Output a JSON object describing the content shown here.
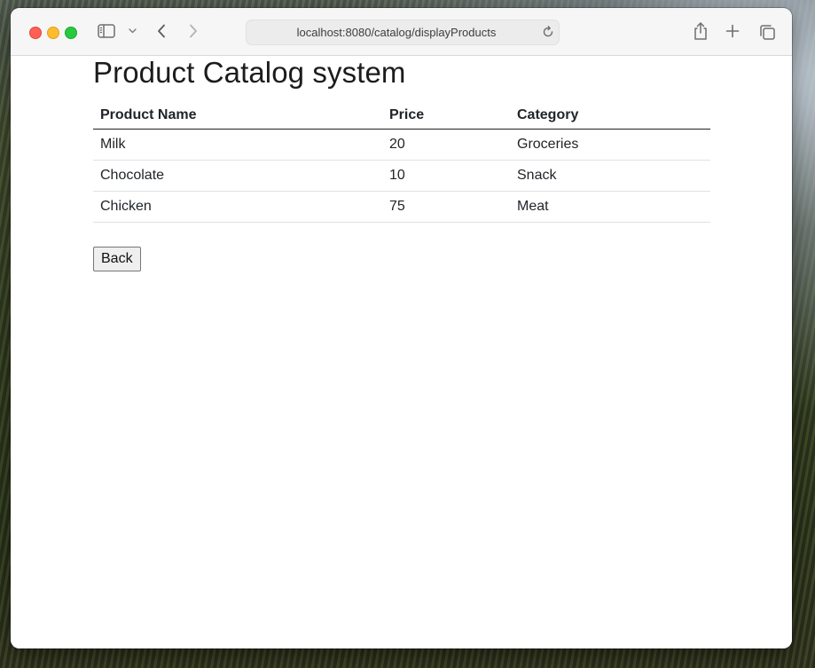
{
  "browser": {
    "url": "localhost:8080/catalog/displayProducts"
  },
  "page": {
    "title": "Product Catalog system",
    "table": {
      "headers": [
        "Product Name",
        "Price",
        "Category"
      ],
      "rows": [
        {
          "name": "Milk",
          "price": "20",
          "category": "Groceries"
        },
        {
          "name": "Chocolate",
          "price": "10",
          "category": "Snack"
        },
        {
          "name": "Chicken",
          "price": "75",
          "category": "Meat"
        }
      ]
    },
    "back_label": "Back"
  },
  "icons": {
    "sidebar": "sidebar-icon",
    "tab_overview_dropdown": "chevron-down-icon",
    "back": "chevron-left-icon",
    "forward": "chevron-right-icon",
    "reload": "reload-icon",
    "share": "share-icon",
    "new_tab": "plus-icon",
    "tabs": "tabs-icon"
  },
  "colors": {
    "close": "#ff5f57",
    "minimize": "#febc2e",
    "maximize": "#28c840"
  }
}
